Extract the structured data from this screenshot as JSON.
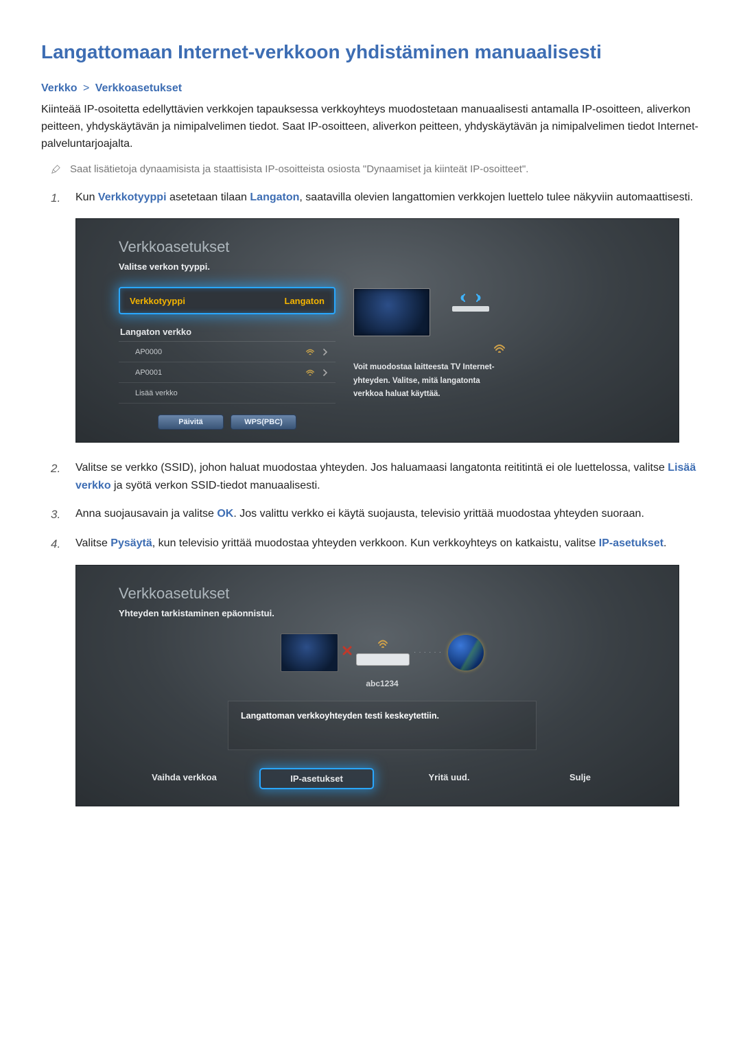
{
  "title": "Langattomaan Internet-verkkoon yhdistäminen manuaalisesti",
  "breadcrumb": {
    "a": "Verkko",
    "sep": ">",
    "b": "Verkkoasetukset"
  },
  "intro": "Kiinteää IP-osoitetta edellyttävien verkkojen tapauksessa verkkoyhteys muodostetaan manuaalisesti antamalla IP-osoitteen, aliverkon peitteen, yhdyskäytävän ja nimipalvelimen tiedot. Saat IP-osoitteen, aliverkon peitteen, yhdyskäytävän ja nimipalvelimen tiedot Internet-palveluntarjoajalta.",
  "note": "Saat lisätietoja dynaamisista ja staattisista IP-osoitteista osiosta \"Dynaamiset ja kiinteät IP-osoitteet\".",
  "steps": {
    "s1": {
      "num": "1.",
      "pre": "Kun ",
      "kw1": "Verkkotyyppi",
      "mid": " asetetaan tilaan ",
      "kw2": "Langaton",
      "post": ", saatavilla olevien langattomien verkkojen luettelo tulee näkyviin automaattisesti."
    },
    "s2": {
      "num": "2.",
      "pre": "Valitse se verkko (SSID), johon haluat muodostaa yhteyden. Jos haluamaasi langatonta reititintä ei ole luettelossa, valitse ",
      "kw": "Lisää verkko",
      "post": " ja syötä verkon SSID-tiedot manuaalisesti."
    },
    "s3": {
      "num": "3.",
      "pre": "Anna suojausavain ja valitse ",
      "kw": "OK",
      "post": ". Jos valittu verkko ei käytä suojausta, televisio yrittää muodostaa yhteyden suoraan."
    },
    "s4": {
      "num": "4.",
      "pre": "Valitse ",
      "kw1": "Pysäytä",
      "mid": ", kun televisio yrittää muodostaa yhteyden verkkoon. Kun verkkoyhteys on katkaistu, valitse ",
      "kw2": "IP-asetukset",
      "post": "."
    }
  },
  "panel1": {
    "title": "Verkkoasetukset",
    "sub": "Valitse verkon tyyppi.",
    "dropdown": {
      "label": "Verkkotyyppi",
      "value": "Langaton"
    },
    "list_label": "Langaton verkko",
    "aps": [
      "AP0000",
      "AP0001",
      "Lisää verkko"
    ],
    "btn_refresh": "Päivitä",
    "btn_wps": "WPS(PBC)",
    "right_text": "Voit muodostaa laitteesta TV Internet-yhteyden. Valitse, mitä langatonta verkkoa haluat käyttää."
  },
  "panel2": {
    "title": "Verkkoasetukset",
    "sub": "Yhteyden tarkistaminen epäonnistui.",
    "ssid": "abc1234",
    "msg": "Langattoman verkkoyhteyden testi keskeytettiin.",
    "buttons": [
      "Vaihda verkkoa",
      "IP-asetukset",
      "Yritä uud.",
      "Sulje"
    ],
    "highlight_index": 1
  }
}
